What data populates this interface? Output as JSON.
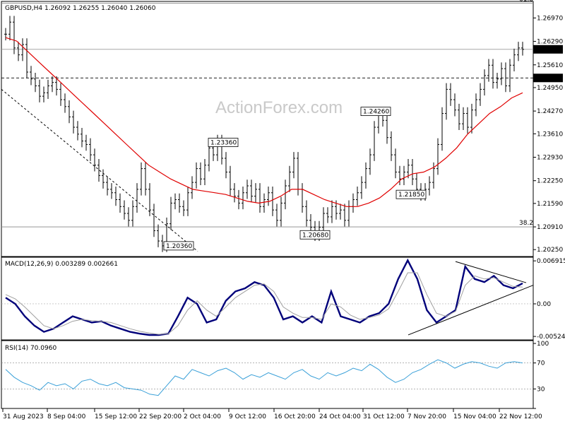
{
  "chart_data": [
    {
      "type": "ohlc",
      "header": "GBPUSD,H4  1.26092 1.26255 1.26040 1.26060",
      "watermark": "ActionForex.com",
      "y_ticks": [
        "1.26970",
        "1.26290",
        "1.25610",
        "1.24950",
        "1.24270",
        "1.23610",
        "1.22930",
        "1.22250",
        "1.21590",
        "1.20910",
        "1.20250"
      ],
      "y_tick_values": [
        1.2697,
        1.2629,
        1.2561,
        1.2495,
        1.2427,
        1.2361,
        1.2293,
        1.2225,
        1.2159,
        1.2091,
        1.2025
      ],
      "ylim": [
        1.2005,
        1.2745
      ],
      "fib_levels": [
        {
          "label": "61.8",
          "value": 1.274
        },
        {
          "label": "38.2",
          "value": 1.2091
        }
      ],
      "current_price": {
        "label": "1.26060",
        "value": 1.2606
      },
      "support_level": {
        "label": "1.25230",
        "value": 1.2523
      },
      "annotations": [
        {
          "label": "1.20360",
          "value": 1.2036
        },
        {
          "label": "1.23360",
          "value": 1.2336
        },
        {
          "label": "1.20680",
          "value": 1.2068
        },
        {
          "label": "1.24260",
          "value": 1.2426
        },
        {
          "label": "1.21850",
          "value": 1.2185
        }
      ],
      "close_series": [
        1.265,
        1.2685,
        1.261,
        1.259,
        1.262,
        1.254,
        1.252,
        1.25,
        1.247,
        1.248,
        1.25,
        1.251,
        1.249,
        1.246,
        1.244,
        1.241,
        1.238,
        1.236,
        1.234,
        1.233,
        1.23,
        1.227,
        1.224,
        1.222,
        1.22,
        1.219,
        1.217,
        1.215,
        1.213,
        1.211,
        1.215,
        1.22,
        1.226,
        1.22,
        1.214,
        1.208,
        1.205,
        1.2036,
        1.21,
        1.216,
        1.217,
        1.215,
        1.214,
        1.219,
        1.222,
        1.226,
        1.223,
        1.227,
        1.232,
        1.23,
        1.234,
        1.229,
        1.225,
        1.22,
        1.218,
        1.216,
        1.219,
        1.221,
        1.218,
        1.22,
        1.215,
        1.217,
        1.219,
        1.214,
        1.211,
        1.216,
        1.221,
        1.225,
        1.229,
        1.22,
        1.215,
        1.211,
        1.209,
        1.2068,
        1.209,
        1.213,
        1.212,
        1.215,
        1.213,
        1.214,
        1.211,
        1.215,
        1.217,
        1.219,
        1.222,
        1.226,
        1.23,
        1.238,
        1.242,
        1.24,
        1.235,
        1.23,
        1.225,
        1.223,
        1.225,
        1.227,
        1.223,
        1.22,
        1.2185,
        1.22,
        1.222,
        1.226,
        1.233,
        1.242,
        1.249,
        1.246,
        1.243,
        1.239,
        1.242,
        1.238,
        1.243,
        1.246,
        1.249,
        1.253,
        1.256,
        1.251,
        1.252,
        1.255,
        1.25,
        1.256,
        1.259,
        1.261,
        1.2606
      ],
      "ma_series": [
        1.264,
        1.263,
        1.26,
        1.257,
        1.254,
        1.251,
        1.248,
        1.245,
        1.242,
        1.239,
        1.236,
        1.233,
        1.23,
        1.227,
        1.225,
        1.223,
        1.2215,
        1.22,
        1.2195,
        1.219,
        1.2185,
        1.2175,
        1.2165,
        1.216,
        1.2165,
        1.218,
        1.22,
        1.22,
        1.2185,
        1.217,
        1.216,
        1.215,
        1.215,
        1.216,
        1.2175,
        1.22,
        1.223,
        1.2245,
        1.225,
        1.2265,
        1.229,
        1.232,
        1.236,
        1.239,
        1.242,
        1.244,
        1.2465,
        1.248
      ],
      "x_ticks": [
        "31 Aug 2023",
        "8 Sep 04:00",
        "15 Sep 12:00",
        "22 Sep 20:00",
        "2 Oct 04:00",
        "9 Oct 12:00",
        "16 Oct 20:00",
        "24 Oct 04:00",
        "31 Oct 12:00",
        "7 Nov 20:00",
        "15 Nov 04:00",
        "22 Nov 12:00"
      ]
    },
    {
      "type": "line",
      "label": "MACD(12,26,9) 0.003289 0.002661",
      "y_ticks": [
        "0.006915",
        "0.00",
        "-0.005241"
      ],
      "y_tick_values": [
        0.006915,
        0.0,
        -0.005241
      ],
      "ylim": [
        -0.0058,
        0.0075
      ],
      "series": [
        {
          "name": "MACD",
          "values": [
            0.001,
            0.0,
            -0.002,
            -0.0035,
            -0.0045,
            -0.004,
            -0.003,
            -0.002,
            -0.0025,
            -0.003,
            -0.0028,
            -0.0035,
            -0.004,
            -0.0045,
            -0.0048,
            -0.005,
            -0.005,
            -0.0048,
            -0.002,
            0.001,
            0.0,
            -0.003,
            -0.0025,
            0.0005,
            0.002,
            0.0025,
            0.0035,
            0.003,
            0.001,
            -0.0025,
            -0.002,
            -0.003,
            -0.002,
            -0.003,
            0.002,
            -0.002,
            -0.0025,
            -0.003,
            -0.002,
            -0.0015,
            0.0,
            0.004,
            0.007,
            0.004,
            -0.001,
            -0.003,
            -0.002,
            -0.001,
            0.006,
            0.004,
            0.0035,
            0.0045,
            0.003,
            0.0025,
            0.0033
          ]
        },
        {
          "name": "Signal",
          "values": [
            0.0015,
            0.0008,
            -0.0005,
            -0.002,
            -0.0035,
            -0.004,
            -0.0035,
            -0.0028,
            -0.0025,
            -0.0027,
            -0.0028,
            -0.003,
            -0.0035,
            -0.004,
            -0.0044,
            -0.0047,
            -0.0049,
            -0.0048,
            -0.0035,
            -0.001,
            0.0005,
            -0.001,
            -0.002,
            -0.0005,
            0.001,
            0.002,
            0.003,
            0.0032,
            0.002,
            -0.0005,
            -0.0015,
            -0.0022,
            -0.0022,
            -0.0025,
            0.0,
            -0.0005,
            -0.0018,
            -0.0025,
            -0.0022,
            -0.0018,
            -0.0008,
            0.002,
            0.005,
            0.005,
            0.0015,
            -0.0015,
            -0.002,
            -0.0012,
            0.003,
            0.0045,
            0.004,
            0.0042,
            0.0035,
            0.0028,
            0.0027
          ]
        }
      ]
    },
    {
      "type": "line",
      "label": "RSI(14) 70.0960",
      "y_ticks": [
        "100",
        "70",
        "30",
        "0"
      ],
      "y_tick_values": [
        100,
        70,
        30,
        0
      ],
      "ylim": [
        0,
        100
      ],
      "series": [
        {
          "name": "RSI",
          "values": [
            60,
            48,
            40,
            35,
            28,
            40,
            35,
            38,
            30,
            42,
            45,
            38,
            35,
            40,
            32,
            30,
            28,
            22,
            20,
            35,
            50,
            45,
            60,
            55,
            50,
            58,
            62,
            55,
            45,
            52,
            48,
            55,
            50,
            45,
            55,
            60,
            50,
            45,
            55,
            50,
            55,
            62,
            58,
            68,
            60,
            48,
            40,
            45,
            55,
            60,
            68,
            75,
            70,
            62,
            68,
            72,
            70,
            65,
            62,
            70,
            72,
            70
          ]
        }
      ]
    }
  ]
}
